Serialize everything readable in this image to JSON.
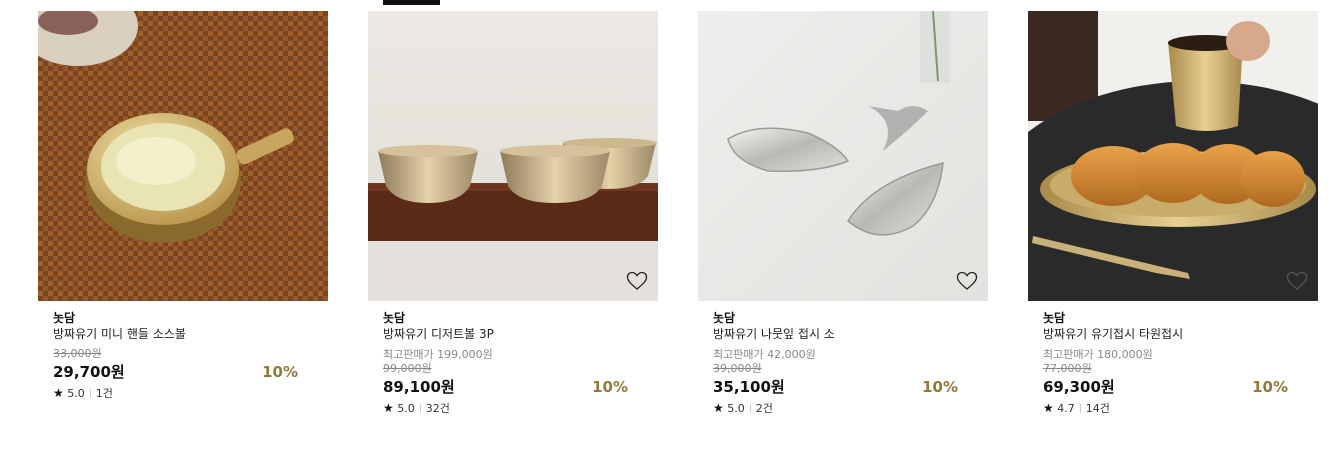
{
  "products": [
    {
      "brand": "놋담",
      "name": "방짜유기 미니 핸들 소스볼",
      "best_price": "",
      "original_price": "33,000원",
      "price": "29,700원",
      "discount": "10%",
      "rating": "5.0",
      "review_count": "1건",
      "image": "brass-mini-handle-sauce-bowl-on-rattan-mat"
    },
    {
      "brand": "놋담",
      "name": "방짜유기 디저트볼 3P",
      "best_price": "최고판매가 199,000원",
      "original_price": "99,000원",
      "price": "89,100원",
      "discount": "10%",
      "rating": "5.0",
      "review_count": "32건",
      "image": "three-brass-dessert-bowls-on-wood-shelf"
    },
    {
      "brand": "놋담",
      "name": "방짜유기 나뭇잎 접시 소",
      "best_price": "최고판매가 42,000원",
      "original_price": "39,000원",
      "price": "35,100원",
      "discount": "10%",
      "rating": "5.0",
      "review_count": "2건",
      "image": "two-leaf-shaped-brass-plates"
    },
    {
      "brand": "놋담",
      "name": "방짜유기 유기접시 타원접시",
      "best_price": "최고판매가 180,000원",
      "original_price": "77,000원",
      "price": "69,300원",
      "discount": "10%",
      "rating": "4.7",
      "review_count": "14건",
      "image": "oval-brass-plate-with-garlic-bread-and-cup"
    }
  ],
  "icons": {
    "wishlist": "heart-outline-icon",
    "rating": "star-icon"
  },
  "colors": {
    "discount": "#8f7a3a",
    "strike": "#888888"
  }
}
